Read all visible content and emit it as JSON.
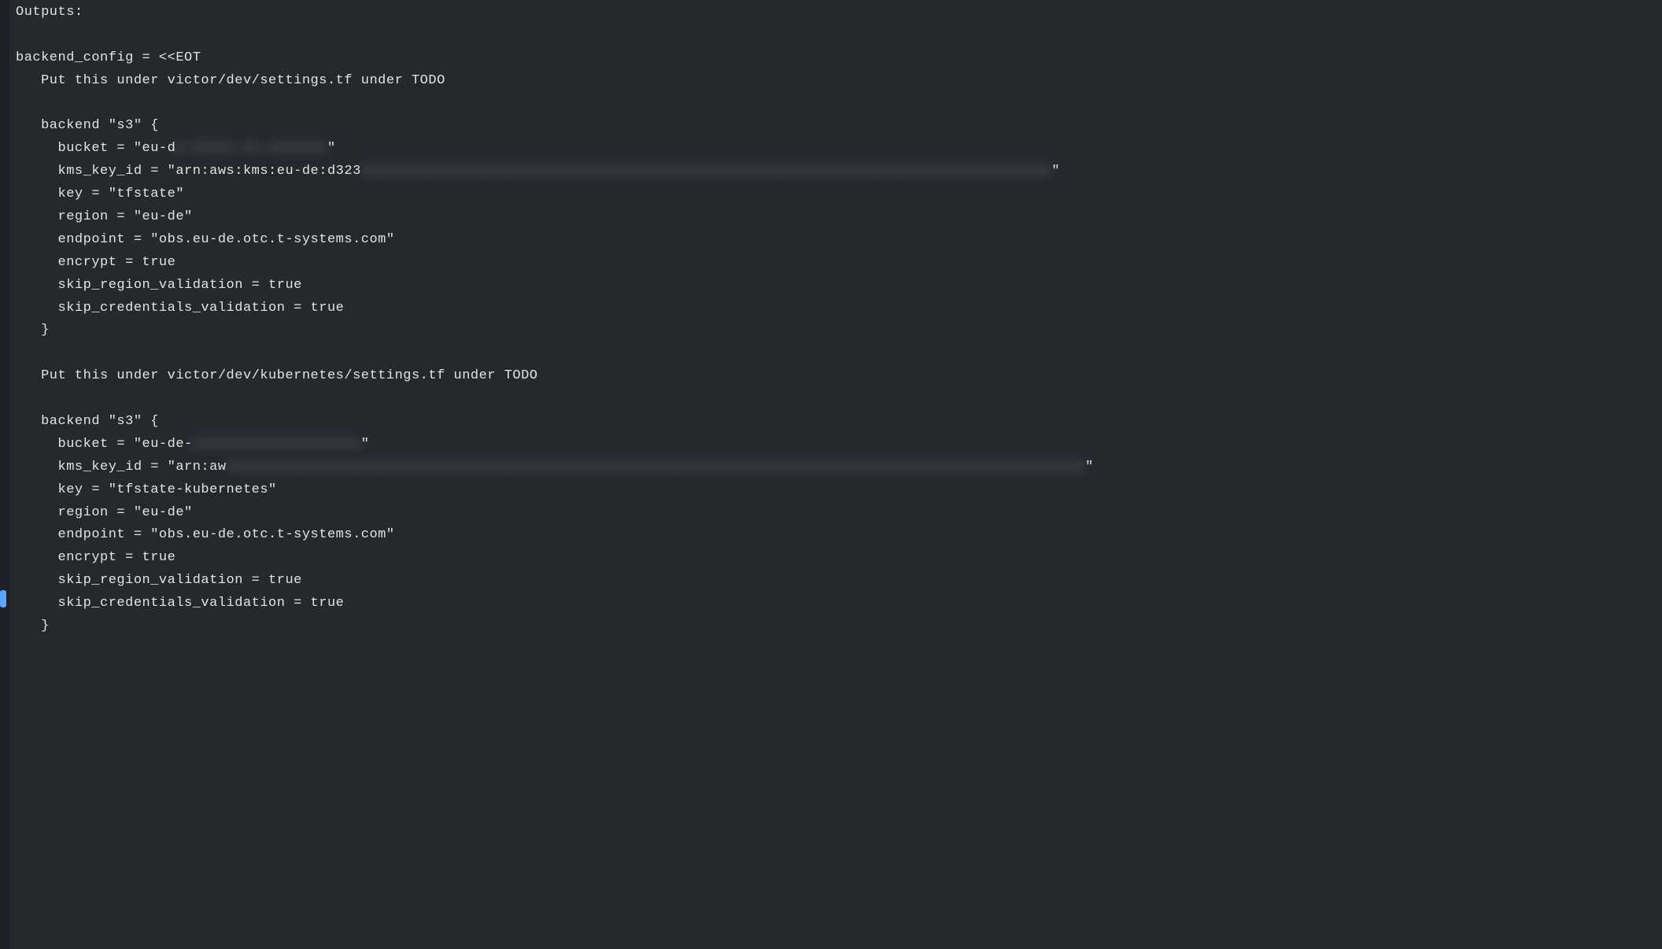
{
  "heading": "Outputs:",
  "lines": [
    "",
    "backend_config = <<EOT",
    "   Put this under victor/dev/settings.tf under TODO",
    "",
    "   backend \"s3\" {",
    "     bucket = \"eu-d",
    "     kms_key_id = \"arn:aws:kms:eu-de:d323",
    "     key = \"tfstate\"",
    "     region = \"eu-de\"",
    "     endpoint = \"obs.eu-de.otc.t-systems.com\"",
    "     encrypt = true",
    "     skip_region_validation = true",
    "     skip_credentials_validation = true",
    "   }",
    "",
    "   Put this under victor/dev/kubernetes/settings.tf under TODO",
    "",
    "   backend \"s3\" {",
    "     bucket = \"eu-de-",
    "     kms_key_id = \"arn:aw",
    "     key = \"tfstate-kubernetes\"",
    "     region = \"eu-de\"",
    "     endpoint = \"obs.eu-de.otc.t-systems.com\"",
    "     encrypt = true",
    "     skip_region_validation = true",
    "     skip_credentials_validation = true",
    "   }"
  ],
  "blurs": {
    "5": {
      "obf": "e-xxxxx-xx-xxxxxxx",
      "tail": "\""
    },
    "6": {
      "obf": "xxxxxxxxxxxxxxxxxxxxxxxxxxxxxxxxxxxxxxxxxxxxxxxxxxxxxxxxxxxxxxxxxxxxxxxxxxxxxxxxxx",
      "tail": "\""
    },
    "18": {
      "obf": "xxxxxxxxxxxxxxxxxxxx",
      "tail": "\""
    },
    "19": {
      "obf": "xxxxxxxxxxxxxxxxxxxxxxxxxxxxxxxxxxxxxxxxxxxxxxxxxxxxxxxxxxxxxxxxxxxxxxxxxxxxxxxxxxxxxxxxxxxxxxxxxxxxxx",
      "tail": "\""
    }
  }
}
